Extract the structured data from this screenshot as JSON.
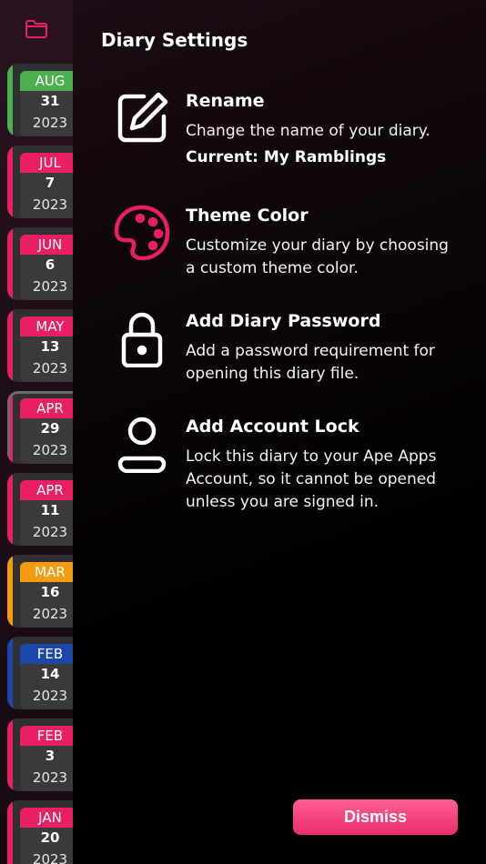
{
  "sidebar": {
    "entries": [
      {
        "month": "AUG",
        "day": "31",
        "year": "2023",
        "color": "#4caf50",
        "stripe": "#4caf50"
      },
      {
        "month": "JUL",
        "day": "7",
        "year": "2023",
        "color": "#e91e63",
        "stripe": "#e91e63"
      },
      {
        "month": "JUN",
        "day": "6",
        "year": "2023",
        "color": "#e91e63",
        "stripe": "#e91e63"
      },
      {
        "month": "MAY",
        "day": "13",
        "year": "2023",
        "color": "#e91e63",
        "stripe": "#e91e63"
      },
      {
        "month": "APR",
        "day": "29",
        "year": "2023",
        "color": "#e91e63",
        "stripe": "#e91e63",
        "selected": true
      },
      {
        "month": "APR",
        "day": "11",
        "year": "2023",
        "color": "#e91e63",
        "stripe": "#e91e63"
      },
      {
        "month": "MAR",
        "day": "16",
        "year": "2023",
        "color": "#f39c12",
        "stripe": "#f39c12"
      },
      {
        "month": "FEB",
        "day": "14",
        "year": "2023",
        "color": "#1a47a8",
        "stripe": "#1a47a8"
      },
      {
        "month": "FEB",
        "day": "3",
        "year": "2023",
        "color": "#e91e63",
        "stripe": "#e91e63"
      },
      {
        "month": "JAN",
        "day": "20",
        "year": "2023",
        "color": "#e91e63",
        "stripe": "#e91e63"
      }
    ]
  },
  "panel": {
    "title": "Diary Settings",
    "options": [
      {
        "heading": "Rename",
        "desc": "Change the name of your diary.",
        "current": "Current: My Ramblings",
        "icon": "edit-icon"
      },
      {
        "heading": "Theme Color",
        "desc": "Customize your diary by choosing a custom theme color.",
        "icon": "palette-icon"
      },
      {
        "heading": "Add Diary Password",
        "desc": "Add a password requirement for opening this diary file.",
        "icon": "lock-icon"
      },
      {
        "heading": "Add Account Lock",
        "desc": "Lock this diary to your Ape Apps Account, so it cannot be opened unless you are signed in.",
        "icon": "person-icon"
      }
    ],
    "dismiss_label": "Dismiss"
  },
  "colors": {
    "accent": "#e91e63",
    "folder": "#e91e63"
  }
}
